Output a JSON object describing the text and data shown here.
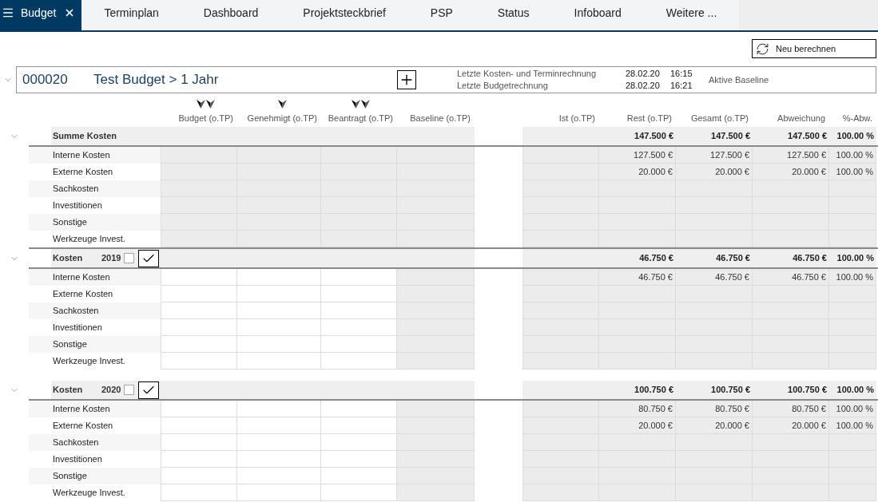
{
  "tabs": [
    {
      "label": "Budget",
      "selected": true
    },
    {
      "label": "Terminplan",
      "selected": false
    },
    {
      "label": "Dashboard",
      "selected": false
    },
    {
      "label": "Projektsteckbrief",
      "selected": false
    },
    {
      "label": "PSP",
      "selected": false
    },
    {
      "label": "Status",
      "selected": false
    },
    {
      "label": "Infoboard",
      "selected": false
    },
    {
      "label": "Weitere ...",
      "selected": false
    }
  ],
  "recalculate_button": {
    "label": "Neu berechnen"
  },
  "project": {
    "number": "000020",
    "name": "Test Budget > 1 Jahr",
    "calculations": [
      {
        "label": "Letzte Kosten- und Terminrechnung",
        "date": "28.02.20",
        "time": "16:15"
      },
      {
        "label": "Letzte Budgetrechnung",
        "date": "28.02.20",
        "time": "16:21"
      }
    ],
    "baseline_label": "Aktive Baseline"
  },
  "columns": {
    "plan": [
      {
        "label": "Budget (o.TP)",
        "editable": true,
        "markers": [
          {
            "kind": "arrowhead"
          },
          {
            "kind": "arrowhead"
          }
        ]
      },
      {
        "label": "Genehmigt (o.TP)",
        "editable": true,
        "markers": [
          {
            "kind": "arrowhead"
          }
        ]
      },
      {
        "label": "Beantragt (o.TP)",
        "editable": true,
        "markers": [
          {
            "kind": "arrowhead"
          },
          {
            "kind": "arrowhead"
          }
        ]
      },
      {
        "label": "Baseline (o.TP)",
        "editable": false
      }
    ],
    "actual": [
      "Ist (o.TP)",
      "Rest (o.TP)",
      "Gesamt (o.TP)",
      "Abweichung",
      "%-Abw."
    ]
  },
  "sections": [
    {
      "kind": "summary",
      "title": "Summe Kosten",
      "expanded": true,
      "totals": [
        "147.500 €",
        "147.500 €",
        "147.500 €",
        "100.00 %"
      ],
      "rows": [
        {
          "label": "Interne Kosten",
          "values": [
            "127.500 €",
            "127.500 €",
            "127.500 €",
            "100.00 %"
          ]
        },
        {
          "label": "Externe Kosten",
          "values": [
            "20.000 €",
            "20.000 €",
            "20.000 €",
            "100.00 %"
          ]
        },
        {
          "label": "Sachkosten"
        },
        {
          "label": "Investitionen"
        },
        {
          "label": "Sonstige"
        },
        {
          "label": "Werkzeuge Invest."
        }
      ]
    },
    {
      "kind": "year",
      "title": "Kosten",
      "year": "2019",
      "checked": false,
      "expanded": true,
      "totals": [
        "46.750 €",
        "46.750 €",
        "46.750 €",
        "100.00 %"
      ],
      "rows": [
        {
          "label": "Interne Kosten",
          "values": [
            "46.750 €",
            "46.750 €",
            "46.750 €",
            "100.00 %"
          ]
        },
        {
          "label": "Externe Kosten"
        },
        {
          "label": "Sachkosten"
        },
        {
          "label": "Investitionen"
        },
        {
          "label": "Sonstige"
        },
        {
          "label": "Werkzeuge Invest."
        }
      ]
    },
    {
      "kind": "year",
      "title": "Kosten",
      "year": "2020",
      "checked": false,
      "expanded": true,
      "totals": [
        "100.750 €",
        "100.750 €",
        "100.750 €",
        "100.00 %"
      ],
      "rows": [
        {
          "label": "Interne Kosten",
          "values": [
            "80.750 €",
            "80.750 €",
            "80.750 €",
            "100.00 %"
          ]
        },
        {
          "label": "Externe Kosten",
          "values": [
            "20.000 €",
            "20.000 €",
            "20.000 €",
            "100.00 %"
          ]
        },
        {
          "label": "Sachkosten"
        },
        {
          "label": "Investitionen"
        },
        {
          "label": "Sonstige"
        },
        {
          "label": "Werkzeuge Invest."
        }
      ]
    }
  ]
}
